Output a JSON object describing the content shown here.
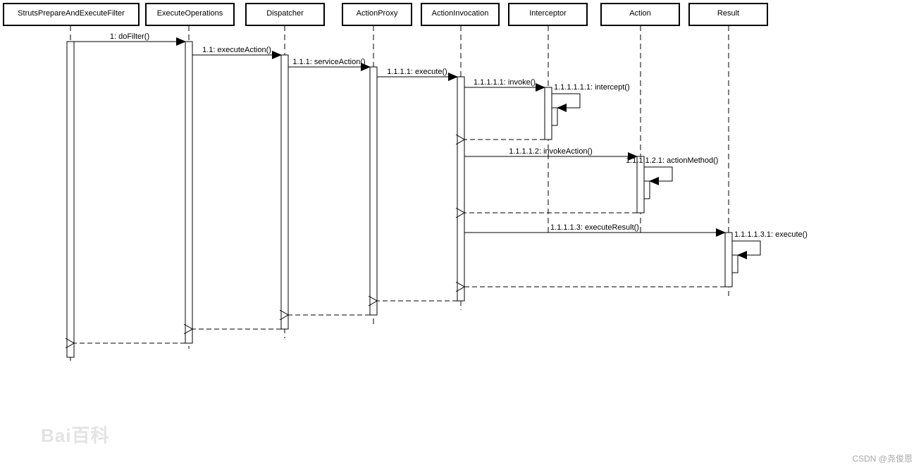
{
  "participants": [
    "StrutsPrepareAndExecuteFilter",
    "ExecuteOperations",
    "Dispatcher",
    "ActionProxy",
    "ActionInvocation",
    "Interceptor",
    "Action",
    "Result"
  ],
  "messages": [
    {
      "label": "1: doFilter()",
      "from": 0,
      "to": 1,
      "kind": "call"
    },
    {
      "label": "1.1: executeAction()",
      "from": 1,
      "to": 2,
      "kind": "call"
    },
    {
      "label": "1.1.1: serviceAction()",
      "from": 2,
      "to": 3,
      "kind": "call"
    },
    {
      "label": "1.1.1.1: execute()",
      "from": 3,
      "to": 4,
      "kind": "call"
    },
    {
      "label": "1.1.1.1.1: invoke()",
      "from": 4,
      "to": 5,
      "kind": "call"
    },
    {
      "label": "1.1.1.1.1.1: intercept()",
      "from": 5,
      "to": 5,
      "kind": "self"
    },
    {
      "label": "",
      "from": 5,
      "to": 4,
      "kind": "return"
    },
    {
      "label": "1.1.1.1.2: invokeAction()",
      "from": 4,
      "to": 6,
      "kind": "call"
    },
    {
      "label": "1.1.1.1.2.1: actionMethod()",
      "from": 6,
      "to": 6,
      "kind": "self"
    },
    {
      "label": "",
      "from": 6,
      "to": 4,
      "kind": "return"
    },
    {
      "label": "1.1.1.1.3: executeResult()",
      "from": 4,
      "to": 7,
      "kind": "call"
    },
    {
      "label": "1.1.1.1.3.1: execute()",
      "from": 7,
      "to": 7,
      "kind": "self"
    },
    {
      "label": "",
      "from": 7,
      "to": 4,
      "kind": "return"
    },
    {
      "label": "",
      "from": 4,
      "to": 3,
      "kind": "return"
    },
    {
      "label": "",
      "from": 3,
      "to": 2,
      "kind": "return"
    },
    {
      "label": "",
      "from": 2,
      "to": 1,
      "kind": "return"
    },
    {
      "label": "",
      "from": 1,
      "to": 0,
      "kind": "return"
    }
  ],
  "watermarks": {
    "baidu": "Bai百科",
    "csdn": "CSDN @尧俊恩"
  }
}
